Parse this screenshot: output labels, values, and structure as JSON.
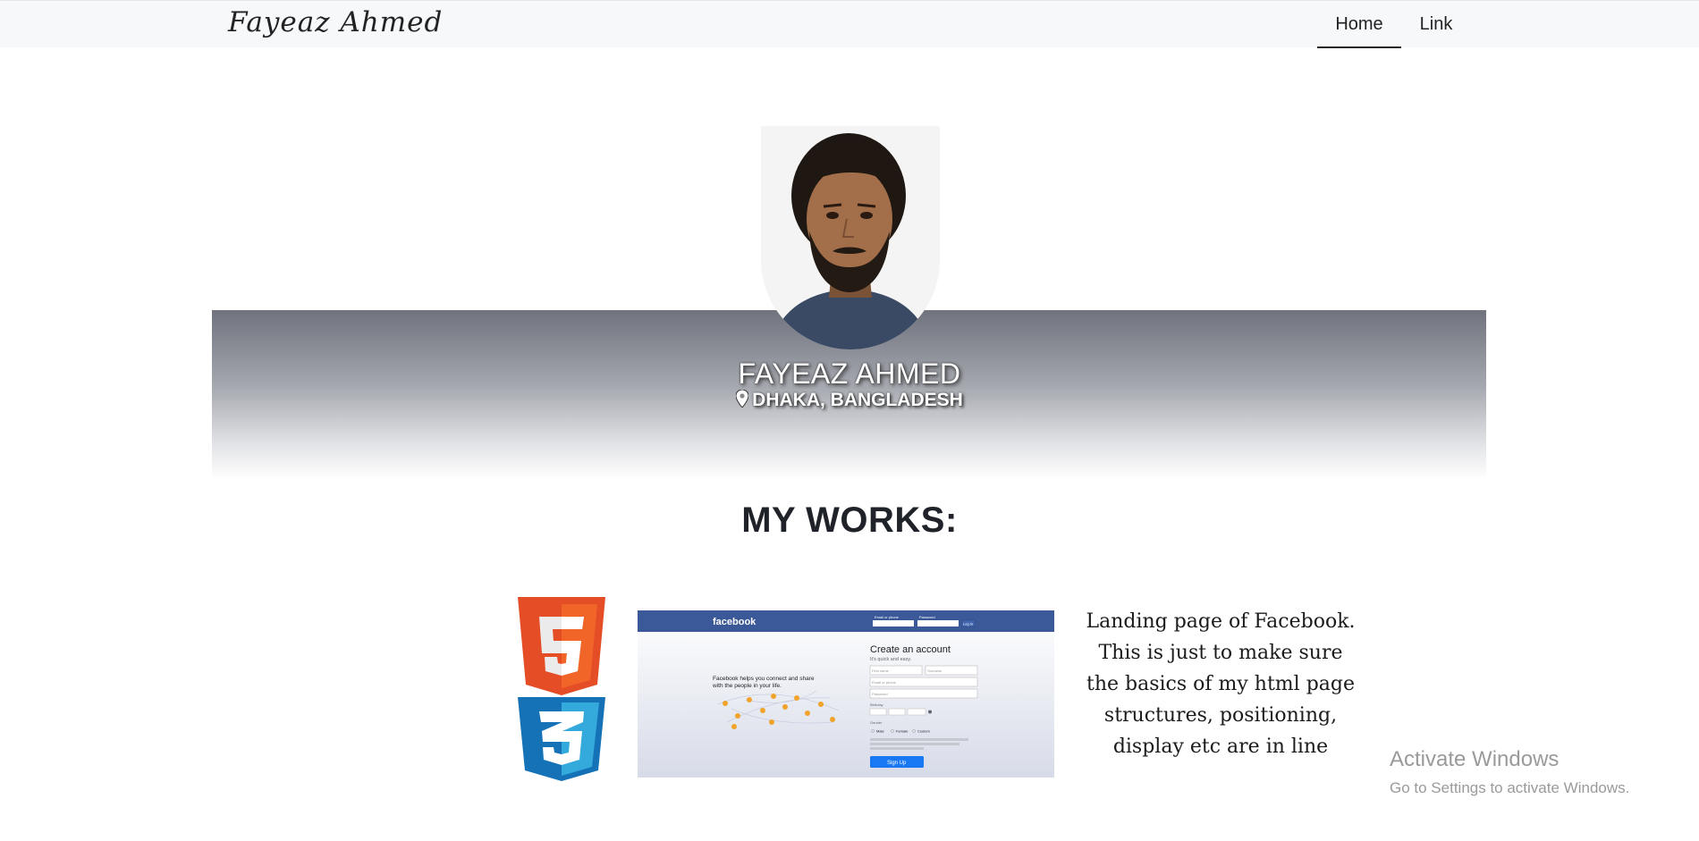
{
  "navbar": {
    "brand": "Fayeaz Ahmed",
    "items": [
      {
        "label": "Home",
        "active": true
      },
      {
        "label": "Link",
        "active": false
      }
    ]
  },
  "profile": {
    "name": "FAYEAZ AHMED",
    "location": "DHAKA, BANGLADESH",
    "location_icon": "map-pin-icon"
  },
  "works": {
    "heading": "MY WORKS:",
    "items": [
      {
        "tech_icons": [
          "html5-icon",
          "css3-icon"
        ],
        "description": "Landing page of Facebook. This is just to make sure the basics of my html page structures, positioning, display etc are in line",
        "screenshot": {
          "logo": "facebook",
          "email_label": "Email or phone",
          "password_label": "Password",
          "login_button": "Log In",
          "heading": "Create an account",
          "subheading": "It's quick and easy.",
          "tagline": "Facebook helps you connect and share with the people in your life.",
          "first_name": "First name",
          "surname": "Surname",
          "email_placeholder": "Email or phone",
          "password_placeholder": "Password",
          "birthday_label": "Birthday",
          "gender_label": "Gender",
          "gender_options": [
            "Male",
            "Female",
            "Custom"
          ],
          "signup_button": "Sign Up"
        }
      }
    ]
  },
  "os_watermark": {
    "title": "Activate Windows",
    "subtitle": "Go to Settings to activate Windows."
  },
  "colors": {
    "html5": "#e44d26",
    "css3": "#1572b6",
    "facebook_blue": "#3b5998",
    "signup_blue": "#1877f2"
  }
}
